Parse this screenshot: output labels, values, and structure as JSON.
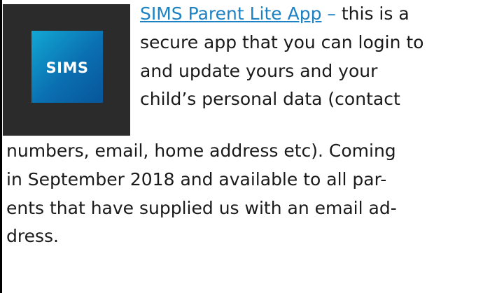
{
  "logo": {
    "text": "SIMS",
    "background_color": "#2b2b2b",
    "tile_color": "#0a7fc0"
  },
  "paragraph": {
    "link_text": "SIMS Parent Lite App",
    "dash": "–",
    "line1_rest": "this is a",
    "line2": "secure app that you can login to",
    "line3": "and update yours and your",
    "line4": "child’s personal data (contact",
    "line5": "numbers, email, home address etc). Coming",
    "line6": "in September 2018 and available to all par-",
    "line7": "ents that have supplied us with an email ad-",
    "line8": "dress."
  },
  "colors": {
    "link": "#1d82c4",
    "text": "#1a1a1a"
  }
}
